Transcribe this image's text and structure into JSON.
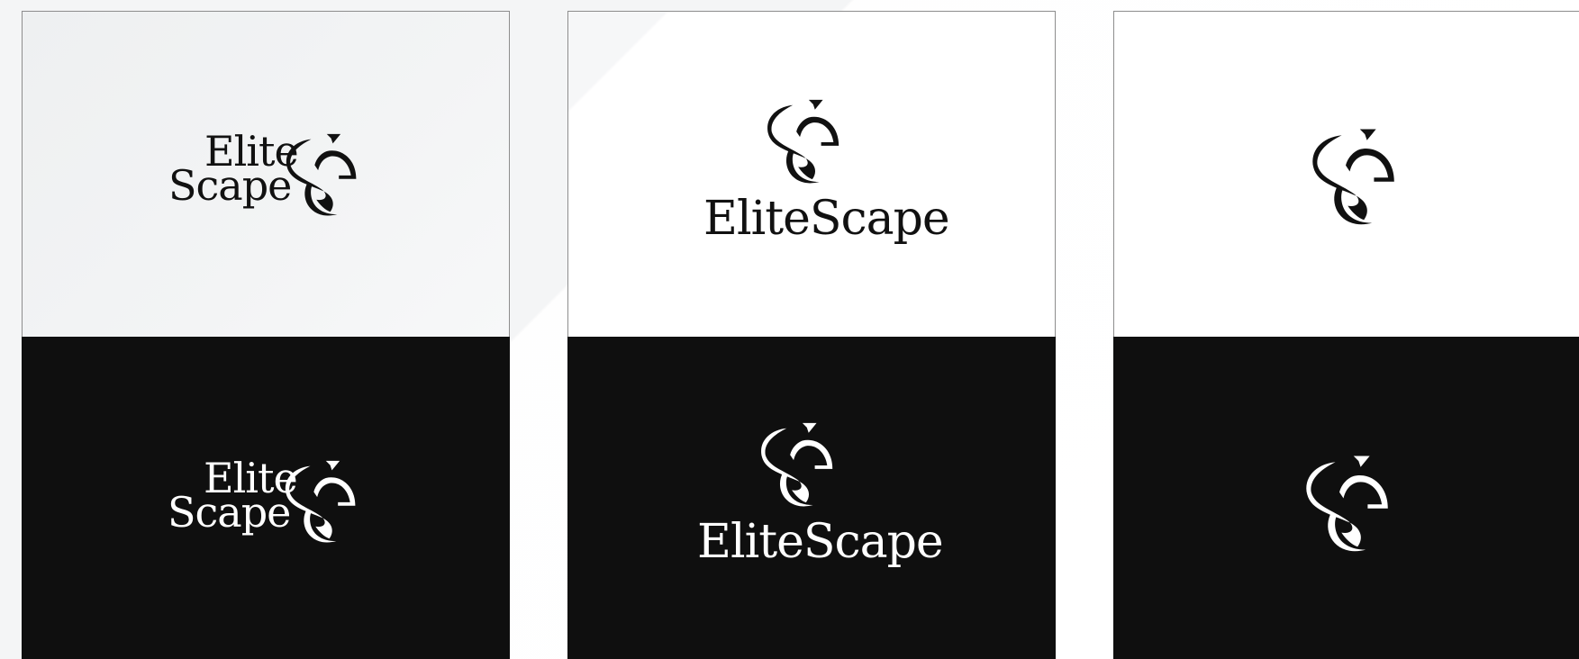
{
  "brand": {
    "stacked_line_1": "Elite",
    "stacked_line_2": "Scape",
    "inline_name": "EliteScape"
  },
  "colors": {
    "mark_dark": "#111111",
    "mark_light": "#ffffff",
    "panel_dark": "#0f0f0f",
    "panel_light": "#ffffff",
    "page_bg": "#f4f5f6"
  },
  "variants": [
    {
      "layout": "horizontal-stacked",
      "backgrounds": [
        "light",
        "dark"
      ]
    },
    {
      "layout": "vertical-wordmark",
      "backgrounds": [
        "light",
        "dark"
      ]
    },
    {
      "layout": "symbol-only",
      "backgrounds": [
        "light",
        "dark"
      ]
    }
  ],
  "icons": {
    "monogram": "es-monogram-icon"
  }
}
